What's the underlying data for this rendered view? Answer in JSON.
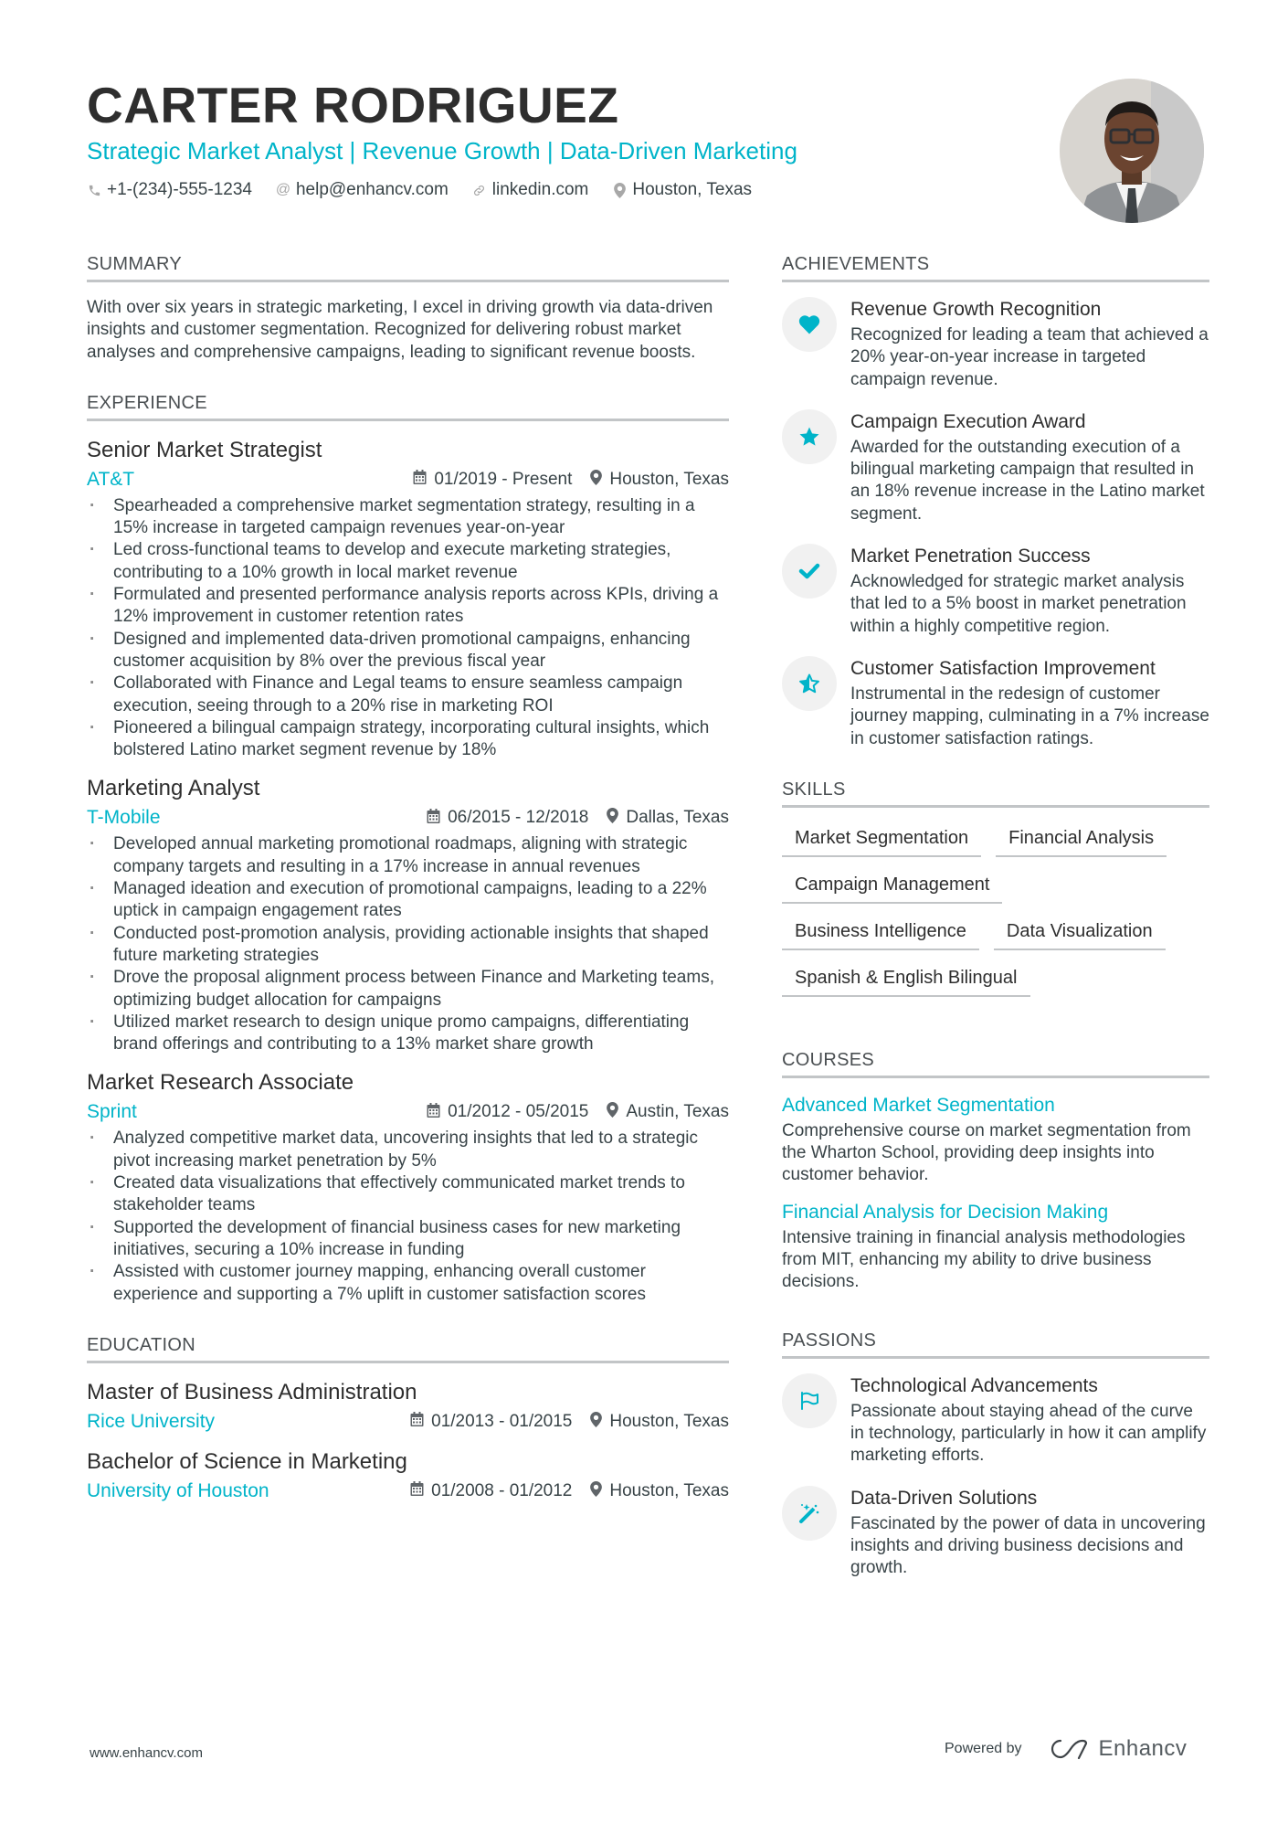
{
  "header": {
    "name": "CARTER RODRIGUEZ",
    "tagline": "Strategic Market Analyst | Revenue Growth | Data-Driven Marketing",
    "contacts": [
      {
        "icon": "phone-icon",
        "text": "+1-(234)-555-1234"
      },
      {
        "icon": "at-icon",
        "text": "help@enhancv.com"
      },
      {
        "icon": "link-icon",
        "text": "linkedin.com"
      },
      {
        "icon": "location-pin-icon",
        "text": "Houston, Texas"
      }
    ],
    "photo_alt": "Profile photo"
  },
  "colors": {
    "accent": "#00b4c9",
    "text": "#384347",
    "heading": "#2e2e2e",
    "rule": "#c2c5c7",
    "icon_bg": "#f1f1f1"
  },
  "summary": {
    "title": "SUMMARY",
    "text": "With over six years in strategic marketing, I excel in driving growth via data-driven insights and customer segmentation. Recognized for delivering robust market analyses and comprehensive campaigns, leading to significant revenue boosts."
  },
  "experience": {
    "title": "EXPERIENCE",
    "jobs": [
      {
        "role": "Senior Market Strategist",
        "company": "AT&T",
        "dates": "01/2019 - Present",
        "location": "Houston, Texas",
        "bullets": [
          "Spearheaded a comprehensive market segmentation strategy, resulting in a 15% increase in targeted campaign revenues year-on-year",
          "Led cross-functional teams to develop and execute marketing strategies, contributing to a 10% growth in local market revenue",
          "Formulated and presented performance analysis reports across KPIs, driving a 12% improvement in customer retention rates",
          "Designed and implemented data-driven promotional campaigns, enhancing customer acquisition by 8% over the previous fiscal year",
          "Collaborated with Finance and Legal teams to ensure seamless campaign execution, seeing through to a 20% rise in marketing ROI",
          "Pioneered a bilingual campaign strategy, incorporating cultural insights, which bolstered Latino market segment revenue by 18%"
        ]
      },
      {
        "role": "Marketing Analyst",
        "company": "T-Mobile",
        "dates": "06/2015 - 12/2018",
        "location": "Dallas, Texas",
        "bullets": [
          "Developed annual marketing promotional roadmaps, aligning with strategic company targets and resulting in a 17% increase in annual revenues",
          "Managed ideation and execution of promotional campaigns, leading to a 22% uptick in campaign engagement rates",
          "Conducted post-promotion analysis, providing actionable insights that shaped future marketing strategies",
          "Drove the proposal alignment process between Finance and Marketing teams, optimizing budget allocation for campaigns",
          "Utilized market research to design unique promo campaigns, differentiating brand offerings and contributing to a 13% market share growth"
        ]
      },
      {
        "role": "Market Research Associate",
        "company": "Sprint",
        "dates": "01/2012 - 05/2015",
        "location": "Austin, Texas",
        "bullets": [
          "Analyzed competitive market data, uncovering insights that led to a strategic pivot increasing market penetration by 5%",
          "Created data visualizations that effectively communicated market trends to stakeholder teams",
          "Supported the development of financial business cases for new marketing initiatives, securing a 10% increase in funding",
          "Assisted with customer journey mapping, enhancing overall customer experience and supporting a 7% uplift in customer satisfaction scores"
        ]
      }
    ]
  },
  "education": {
    "title": "EDUCATION",
    "items": [
      {
        "degree": "Master of Business Administration",
        "school": "Rice University",
        "dates": "01/2013 - 01/2015",
        "location": "Houston, Texas"
      },
      {
        "degree": "Bachelor of Science in Marketing",
        "school": "University of Houston",
        "dates": "01/2008 - 01/2012",
        "location": "Houston, Texas"
      }
    ]
  },
  "achievements": {
    "title": "ACHIEVEMENTS",
    "items": [
      {
        "icon": "heart-icon",
        "title": "Revenue Growth Recognition",
        "desc": "Recognized for leading a team that achieved a 20% year-on-year increase in targeted campaign revenue."
      },
      {
        "icon": "star-icon",
        "title": "Campaign Execution Award",
        "desc": "Awarded for the outstanding execution of a bilingual marketing campaign that resulted in an 18% revenue increase in the Latino market segment."
      },
      {
        "icon": "check-icon",
        "title": "Market Penetration Success",
        "desc": "Acknowledged for strategic market analysis that led to a 5% boost in market penetration within a highly competitive region."
      },
      {
        "icon": "half-star-icon",
        "title": "Customer Satisfaction Improvement",
        "desc": "Instrumental in the redesign of customer journey mapping, culminating in a 7% increase in customer satisfaction ratings."
      }
    ]
  },
  "skills": {
    "title": "SKILLS",
    "items": [
      "Market Segmentation",
      "Financial Analysis",
      "Campaign Management",
      "Business Intelligence",
      "Data Visualization",
      "Spanish & English Bilingual"
    ]
  },
  "courses": {
    "title": "COURSES",
    "items": [
      {
        "title": "Advanced Market Segmentation",
        "desc": "Comprehensive course on market segmentation from the Wharton School, providing deep insights into customer behavior."
      },
      {
        "title": "Financial Analysis for Decision Making",
        "desc": "Intensive training in financial analysis methodologies from MIT, enhancing my ability to drive business decisions."
      }
    ]
  },
  "passions": {
    "title": "PASSIONS",
    "items": [
      {
        "icon": "flag-icon",
        "title": "Technological Advancements",
        "desc": "Passionate about staying ahead of the curve in technology, particularly in how it can amplify marketing efforts."
      },
      {
        "icon": "magic-wand-icon",
        "title": "Data-Driven Solutions",
        "desc": "Fascinated by the power of data in uncovering insights and driving business decisions and growth."
      }
    ]
  },
  "footer": {
    "website": "www.enhancv.com",
    "powered_by": "Powered by",
    "brand": "Enhancv"
  }
}
